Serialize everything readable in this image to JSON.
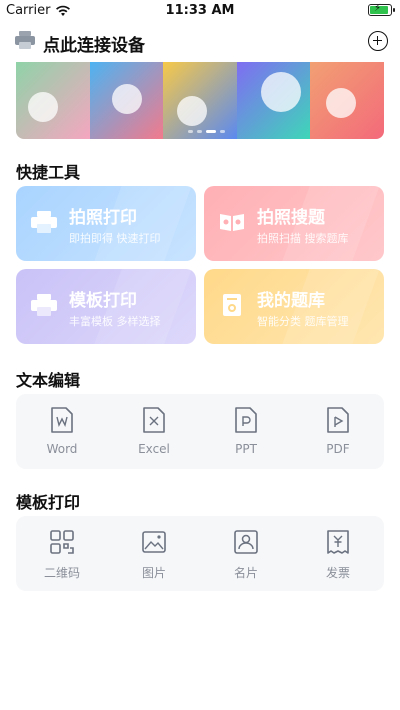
{
  "status_bar": {
    "carrier": "Carrier",
    "time": "11:33 AM"
  },
  "header": {
    "title": "点此连接设备",
    "printer_icon": "printer-icon",
    "add_icon": "plus-circle-icon"
  },
  "banner": {
    "slides": 5,
    "active_index": 2
  },
  "quick_tools": {
    "title": "快捷工具",
    "cards": [
      {
        "title": "拍照打印",
        "subtitle": "即拍即得 快速打印",
        "icon": "printer-icon",
        "color": "#a9d4ff"
      },
      {
        "title": "拍照搜题",
        "subtitle": "拍照扫描 搜索题库",
        "icon": "book-icon",
        "color": "#ffb0b4"
      },
      {
        "title": "模板打印",
        "subtitle": "丰富模板 多样选择",
        "icon": "printer-icon",
        "color": "#c9c2f7"
      },
      {
        "title": "我的题库",
        "subtitle": "智能分类 题库管理",
        "icon": "document-icon",
        "color": "#ffd98a"
      }
    ]
  },
  "text_edit": {
    "title": "文本编辑",
    "items": [
      {
        "label": "Word",
        "icon": "word-file-icon"
      },
      {
        "label": "Excel",
        "icon": "excel-file-icon"
      },
      {
        "label": "PPT",
        "icon": "ppt-file-icon"
      },
      {
        "label": "PDF",
        "icon": "pdf-file-icon"
      }
    ]
  },
  "template_print": {
    "title": "模板打印",
    "items": [
      {
        "label": "二维码",
        "icon": "qr-code-icon"
      },
      {
        "label": "图片",
        "icon": "image-icon"
      },
      {
        "label": "名片",
        "icon": "business-card-icon"
      },
      {
        "label": "发票",
        "icon": "invoice-icon"
      }
    ]
  }
}
